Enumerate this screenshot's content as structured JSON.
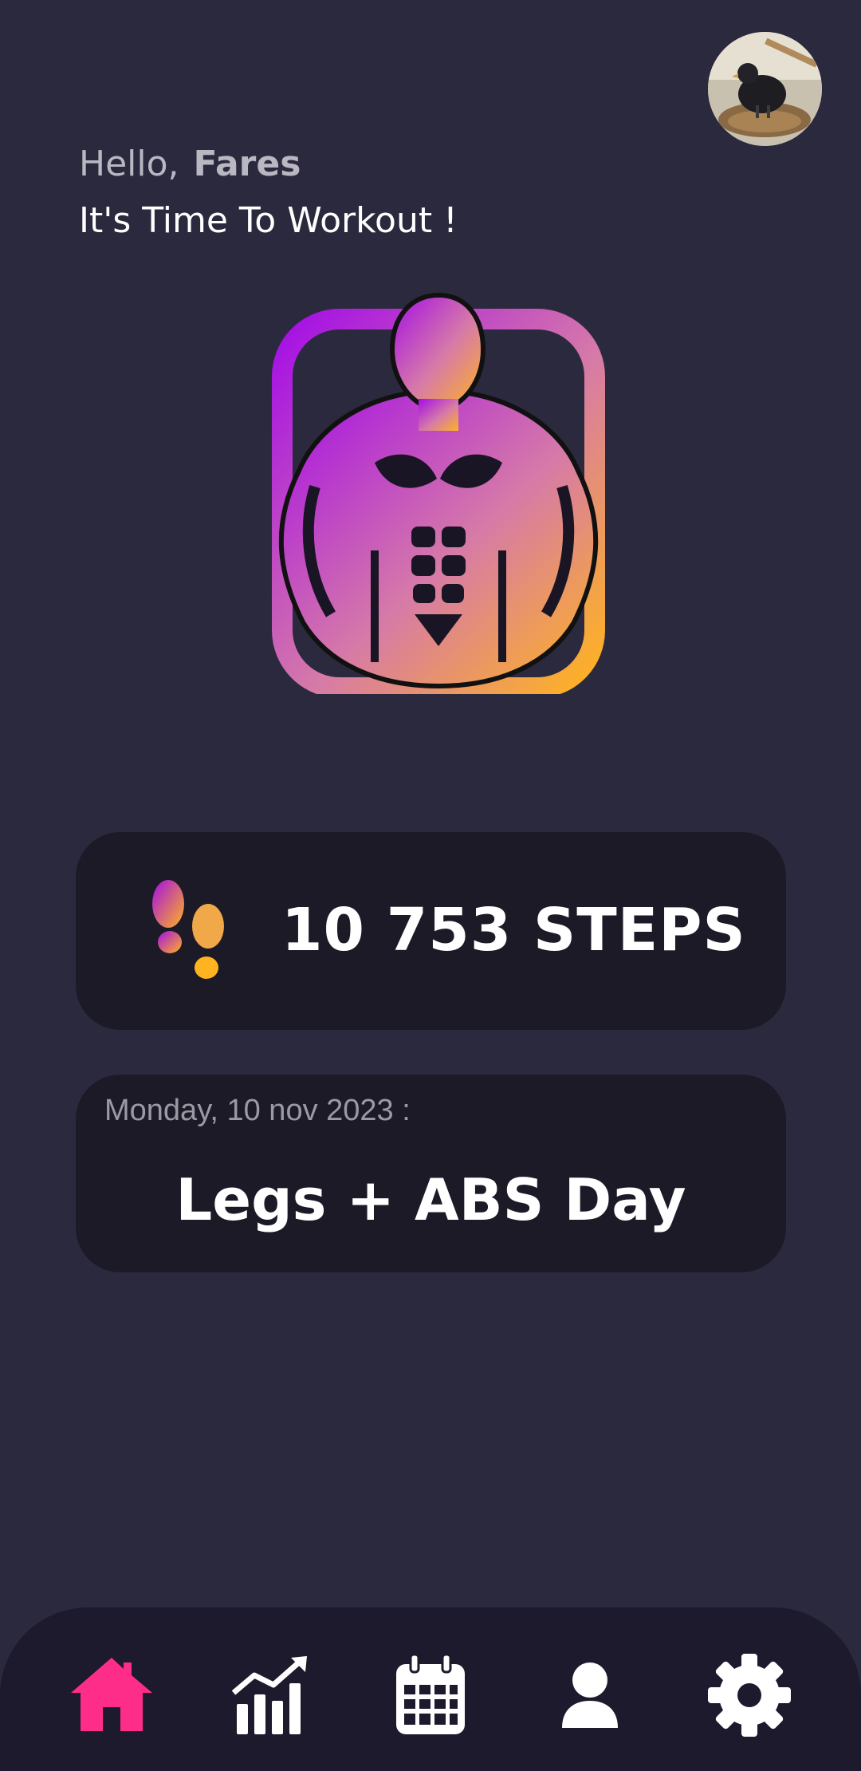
{
  "header": {
    "greeting": "Hello,",
    "user_name": "Fares",
    "subtitle": "It's Time To Workout !"
  },
  "avatar": {
    "icon": "user-avatar-photo"
  },
  "logo": {
    "icon": "muscle-man-logo"
  },
  "steps": {
    "value": "10 753 STEPS",
    "icon": "footprints-icon"
  },
  "workout": {
    "date": "Monday, 10 nov 2023 :",
    "title": "Legs + ABS Day"
  },
  "nav": {
    "items": [
      {
        "name": "home",
        "icon": "home-icon",
        "active": true
      },
      {
        "name": "statistics",
        "icon": "chart-icon",
        "active": false
      },
      {
        "name": "calendar",
        "icon": "calendar-icon",
        "active": false
      },
      {
        "name": "profile",
        "icon": "user-icon",
        "active": false
      },
      {
        "name": "settings",
        "icon": "gear-icon",
        "active": false
      }
    ]
  },
  "colors": {
    "background": "#2b293d",
    "card": "#1c1a26",
    "nav_background": "#1c1a2c",
    "accent_active": "#ff2d8a",
    "gradient_start": "#a40ee6",
    "gradient_end": "#ffb320"
  }
}
